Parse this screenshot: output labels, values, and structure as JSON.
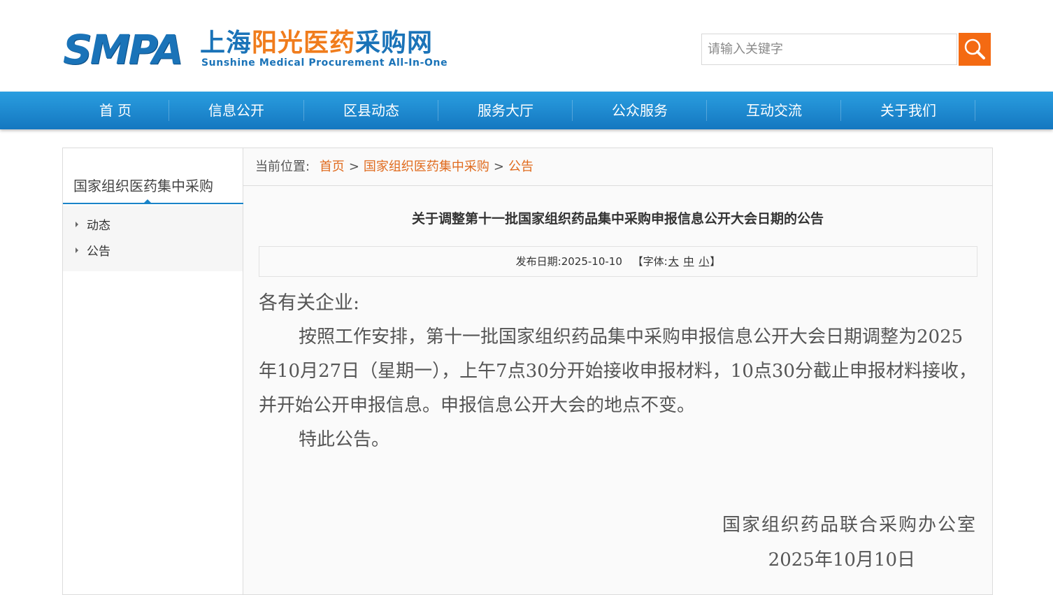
{
  "header": {
    "logo_smpa": "SMPA",
    "logo_cn_part1": "上海",
    "logo_cn_part2": "阳光医药",
    "logo_cn_part3": "采购网",
    "logo_en": "Sunshine Medical Procurement All-In-One",
    "search_placeholder": "请输入关键字"
  },
  "nav": {
    "items": [
      "首 页",
      "信息公开",
      "区县动态",
      "服务大厅",
      "公众服务",
      "互动交流",
      "关于我们"
    ]
  },
  "sidebar": {
    "title": "国家组织医药集中采购",
    "items": [
      "动态",
      "公告"
    ]
  },
  "breadcrumb": {
    "label": "当前位置:",
    "links": [
      "首页",
      "国家组织医药集中采购",
      "公告"
    ],
    "separator": ">"
  },
  "article": {
    "title": "关于调整第十一批国家组织药品集中采购申报信息公开大会日期的公告",
    "date_label": "发布日期:",
    "date": "2025-10-10",
    "font_label_open": "【字体:",
    "font_sizes": [
      "大",
      "中",
      "小"
    ],
    "font_label_close": "】",
    "greeting": "各有关企业:",
    "paragraphs": [
      "按照工作安排，第十一批国家组织药品集中采购申报信息公开大会日期调整为2025年10月27日（星期一），上午7点30分开始接收申报材料，10点30分截止申报材料接收，并开始公开申报信息。申报信息公开大会的地点不变。",
      "特此公告。"
    ],
    "signature_org": "国家组织药品联合采购办公室",
    "signature_date": "2025年10月10日"
  },
  "colors": {
    "brand_blue": "#1a73b8",
    "brand_orange": "#f07c1c",
    "nav_blue": "#1e8ad0",
    "link_orange": "#e06b1e",
    "search_button": "#f46a12"
  }
}
